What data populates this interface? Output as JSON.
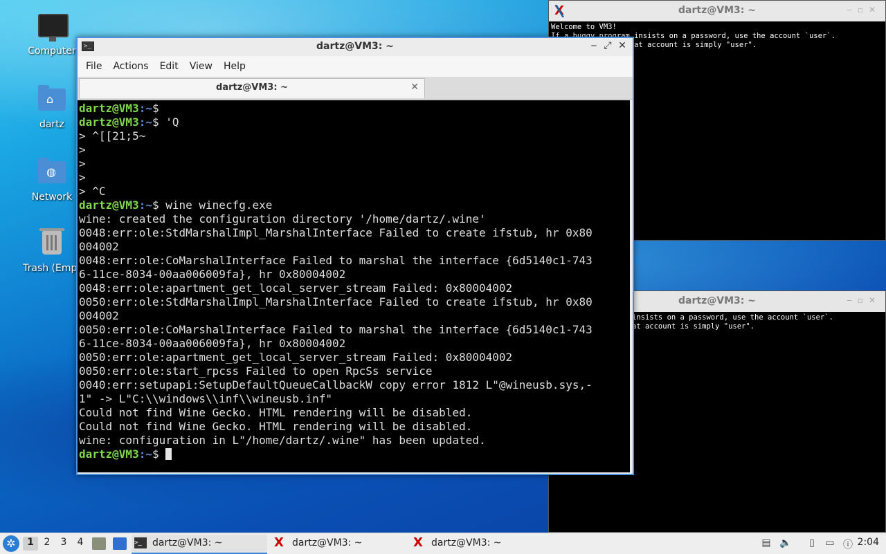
{
  "desktop": {
    "icons": [
      {
        "label": "Computer"
      },
      {
        "label": "dartz"
      },
      {
        "label": "Network"
      },
      {
        "label": "Trash (Empt"
      }
    ]
  },
  "bg_xterm_top": {
    "title": "dartz@VM3: ~",
    "lines": [
      "Welcome to VM3!",
      "If a buggy program insists on a password, use the account `user`.",
      "The password for that account is simply \"user\"."
    ]
  },
  "bg_xterm_bottom": {
    "title": "dartz@VM3: ~",
    "lines": [
      "insists on a password, use the account `user`.",
      "at account is simply \"user\"."
    ]
  },
  "terminal": {
    "title": "dartz@VM3: ~",
    "menu": [
      "File",
      "Actions",
      "Edit",
      "View",
      "Help"
    ],
    "tab_label": "dartz@VM3: ~",
    "prompt_user": "dartz@VM3",
    "prompt_path": ":~",
    "prompt_symbol": "$",
    "lines": [
      {
        "prompt": true,
        "text": ""
      },
      {
        "prompt": true,
        "text": " 'Q"
      },
      {
        "prompt": false,
        "text": "> ^[[21;5~"
      },
      {
        "prompt": false,
        "text": ">"
      },
      {
        "prompt": false,
        "text": ">"
      },
      {
        "prompt": false,
        "text": ">"
      },
      {
        "prompt": false,
        "text": "> ^C"
      },
      {
        "prompt": true,
        "text": " wine winecfg.exe"
      },
      {
        "prompt": false,
        "text": "wine: created the configuration directory '/home/dartz/.wine'"
      },
      {
        "prompt": false,
        "text": "0048:err:ole:StdMarshalImpl_MarshalInterface Failed to create ifstub, hr 0x80"
      },
      {
        "prompt": false,
        "text": "004002"
      },
      {
        "prompt": false,
        "text": "0048:err:ole:CoMarshalInterface Failed to marshal the interface {6d5140c1-743"
      },
      {
        "prompt": false,
        "text": "6-11ce-8034-00aa006009fa}, hr 0x80004002"
      },
      {
        "prompt": false,
        "text": "0048:err:ole:apartment_get_local_server_stream Failed: 0x80004002"
      },
      {
        "prompt": false,
        "text": "0050:err:ole:StdMarshalImpl_MarshalInterface Failed to create ifstub, hr 0x80"
      },
      {
        "prompt": false,
        "text": "004002"
      },
      {
        "prompt": false,
        "text": "0050:err:ole:CoMarshalInterface Failed to marshal the interface {6d5140c1-743"
      },
      {
        "prompt": false,
        "text": "6-11ce-8034-00aa006009fa}, hr 0x80004002"
      },
      {
        "prompt": false,
        "text": "0050:err:ole:apartment_get_local_server_stream Failed: 0x80004002"
      },
      {
        "prompt": false,
        "text": "0050:err:ole:start_rpcss Failed to open RpcSs service"
      },
      {
        "prompt": false,
        "text": "0040:err:setupapi:SetupDefaultQueueCallbackW copy error 1812 L\"@wineusb.sys,-"
      },
      {
        "prompt": false,
        "text": "1\" -> L\"C:\\\\windows\\\\inf\\\\wineusb.inf\""
      },
      {
        "prompt": false,
        "text": "Could not find Wine Gecko. HTML rendering will be disabled."
      },
      {
        "prompt": false,
        "text": "Could not find Wine Gecko. HTML rendering will be disabled."
      },
      {
        "prompt": false,
        "text": "wine: configuration in L\"/home/dartz/.wine\" has been updated."
      },
      {
        "prompt": true,
        "text": " ",
        "cursor": true
      }
    ]
  },
  "taskbar": {
    "workspaces": [
      "1",
      "2",
      "3",
      "4"
    ],
    "tasks": [
      {
        "label": "dartz@VM3: ~",
        "icon": "terminal-icon"
      },
      {
        "label": "dartz@VM3: ~",
        "icon": "x-icon"
      },
      {
        "label": "dartz@VM3: ~",
        "icon": "x-icon"
      }
    ],
    "clock": "2:04"
  }
}
